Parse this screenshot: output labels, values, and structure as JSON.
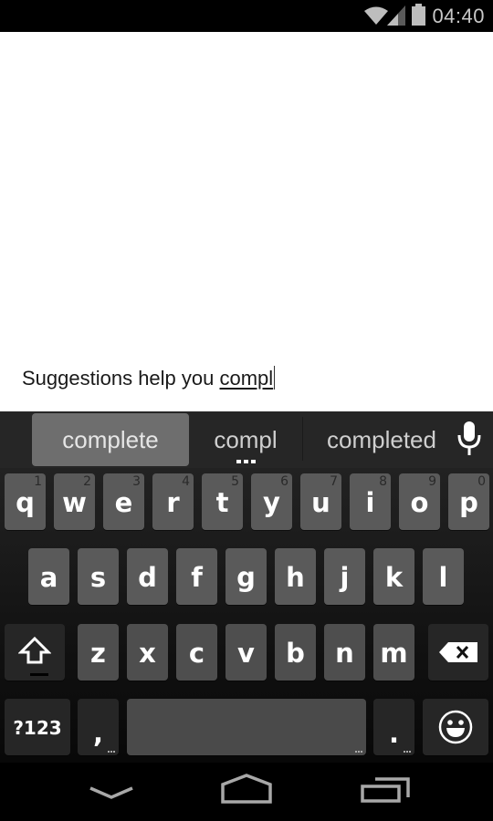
{
  "status_bar": {
    "time": "04:40",
    "icons": [
      "wifi-icon",
      "cell-signal-icon",
      "battery-icon"
    ]
  },
  "editor": {
    "committed_text": "Suggestions help you ",
    "composing_text": "compl"
  },
  "keyboard": {
    "suggestions": {
      "primary": "complete",
      "typed": "compl",
      "alternate": "completed",
      "voice_icon": "microphone-icon"
    },
    "rows": [
      [
        {
          "label": "q",
          "hint": "1"
        },
        {
          "label": "w",
          "hint": "2"
        },
        {
          "label": "e",
          "hint": "3"
        },
        {
          "label": "r",
          "hint": "4"
        },
        {
          "label": "t",
          "hint": "5"
        },
        {
          "label": "y",
          "hint": "6"
        },
        {
          "label": "u",
          "hint": "7"
        },
        {
          "label": "i",
          "hint": "8"
        },
        {
          "label": "o",
          "hint": "9"
        },
        {
          "label": "p",
          "hint": "0"
        }
      ],
      [
        {
          "label": "a"
        },
        {
          "label": "s"
        },
        {
          "label": "d"
        },
        {
          "label": "f"
        },
        {
          "label": "g"
        },
        {
          "label": "h"
        },
        {
          "label": "j"
        },
        {
          "label": "k"
        },
        {
          "label": "l"
        }
      ],
      [
        {
          "label": "z"
        },
        {
          "label": "x"
        },
        {
          "label": "c"
        },
        {
          "label": "v"
        },
        {
          "label": "b"
        },
        {
          "label": "n"
        },
        {
          "label": "m"
        }
      ]
    ],
    "shift_icon": "shift-arrow-icon",
    "backspace_icon": "backspace-icon",
    "symbols_label": "?123",
    "comma_label": ",",
    "period_label": ".",
    "emoji_icon": "smiley-icon"
  },
  "nav_bar": {
    "buttons": [
      "back-down-chevron-icon",
      "home-icon",
      "recent-apps-icon"
    ]
  }
}
